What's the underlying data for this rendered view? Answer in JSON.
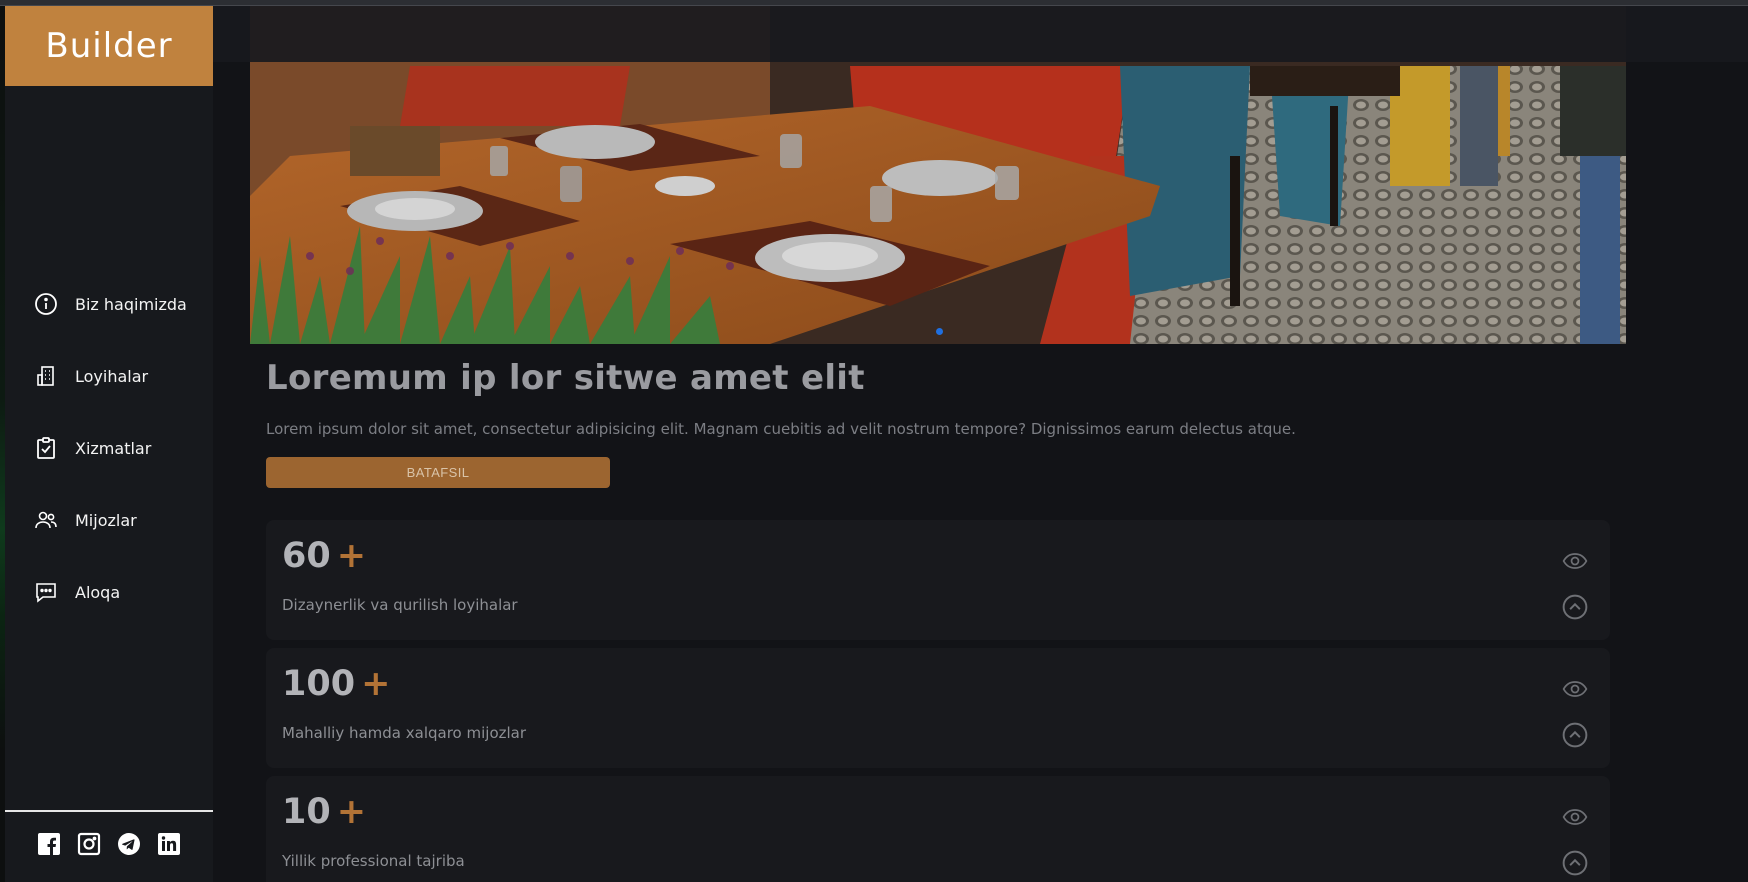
{
  "brand": {
    "name": "Builder"
  },
  "colors": {
    "accent": "#c0823e",
    "button": "#9c6530",
    "plus": "#b27336",
    "carousel_dot": "#1f6fe0"
  },
  "sidebar": {
    "items": [
      {
        "label": "Biz haqimizda",
        "icon": "info-icon"
      },
      {
        "label": "Loyihalar",
        "icon": "building-icon"
      },
      {
        "label": "Xizmatlar",
        "icon": "clipboard-check-icon"
      },
      {
        "label": "Mijozlar",
        "icon": "users-icon"
      },
      {
        "label": "Aloqa",
        "icon": "chat-icon"
      }
    ],
    "socials": [
      "facebook-icon",
      "instagram-icon",
      "telegram-icon",
      "linkedin-icon"
    ]
  },
  "hero": {
    "title": "Loremum ip lor sitwe amet elit",
    "text": "Lorem ipsum dolor sit amet, consectetur adipisicing elit. Magnam cuebitis ad velit nostrum tempore? Dignissimos earum delectus atque.",
    "button_label": "BATAFSIL"
  },
  "stats": [
    {
      "value": "60",
      "plus": "+",
      "label": "Dizaynerlik va qurilish loyihalar"
    },
    {
      "value": "100",
      "plus": "+",
      "label": "Mahalliy hamda xalqaro mijozlar"
    },
    {
      "value": "10",
      "plus": "+",
      "label": "Yillik professional tajriba"
    }
  ]
}
